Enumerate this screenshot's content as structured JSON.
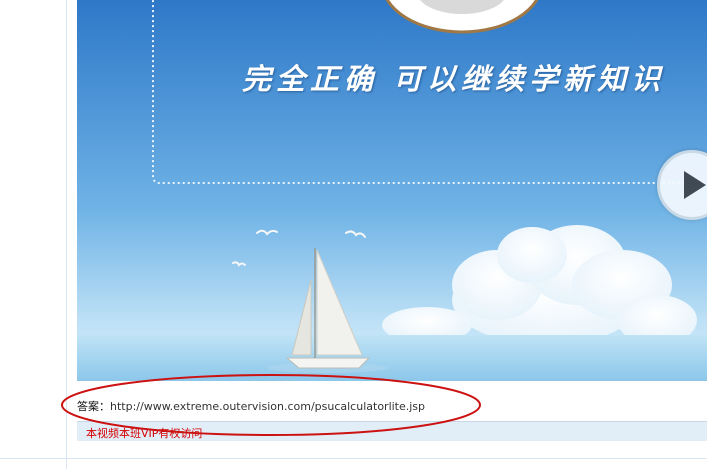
{
  "video": {
    "banner_text": "完全正确 可以继续学新知识",
    "play_icon": "play-icon",
    "colors": {
      "sky_top": "#2e78c8",
      "sky_bottom": "#bfe1f6",
      "sea": "#9fd0ec"
    }
  },
  "answer": {
    "label": "答案：",
    "url": "http://www.extreme.outervision.com/psucalculatorlite.jsp"
  },
  "notice": {
    "text": "本视频本班VIP有权访问",
    "color": "#d40000"
  },
  "annotation": {
    "color": "#cc1111"
  }
}
